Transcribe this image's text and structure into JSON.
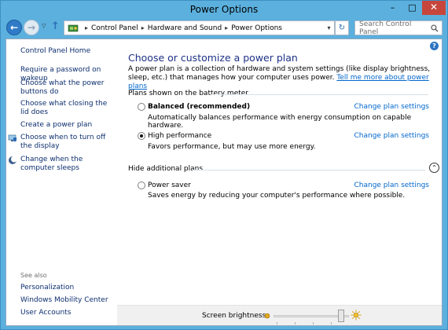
{
  "window": {
    "title": "Power Options",
    "minimize": "–",
    "maximize": "□",
    "close": "✕"
  },
  "nav": {
    "back": "←",
    "forward": "→",
    "recent": "▽",
    "up": "↑",
    "breadcrumb": [
      "Control Panel",
      "Hardware and Sound",
      "Power Options"
    ],
    "dropdown": "▾",
    "refresh": "↻",
    "search_placeholder": "Search Control Panel"
  },
  "sidebar": {
    "home": "Control Panel Home",
    "items": [
      "Require a password on wakeup",
      "Choose what the power buttons do",
      "Choose what closing the lid does",
      "Create a power plan",
      "Choose when to turn off the display",
      "Change when the computer sleeps"
    ],
    "see_also": "See also",
    "see_also_items": [
      "Personalization",
      "Windows Mobility Center",
      "User Accounts"
    ]
  },
  "main": {
    "help": "?",
    "heading": "Choose or customize a power plan",
    "description": "A power plan is a collection of hardware and system settings (like display brightness, sleep, etc.) that manages how your computer uses power.",
    "learn_more": "Tell me more about power plans",
    "group_battery": "Plans shown on the battery meter",
    "group_hidden": "Hide additional plans",
    "collapse": "⌃",
    "plans": [
      {
        "name": "Balanced (recommended)",
        "desc": "Automatically balances performance with energy consumption on capable hardware.",
        "change": "Change plan settings",
        "selected": false
      },
      {
        "name": "High performance",
        "desc": "Favors performance, but may use more energy.",
        "change": "Change plan settings",
        "selected": true
      },
      {
        "name": "Power saver",
        "desc": "Saves energy by reducing your computer's performance where possible.",
        "change": "Change plan settings",
        "selected": false
      }
    ]
  },
  "brightness": {
    "label": "Screen brightness:",
    "level": 0.9
  }
}
